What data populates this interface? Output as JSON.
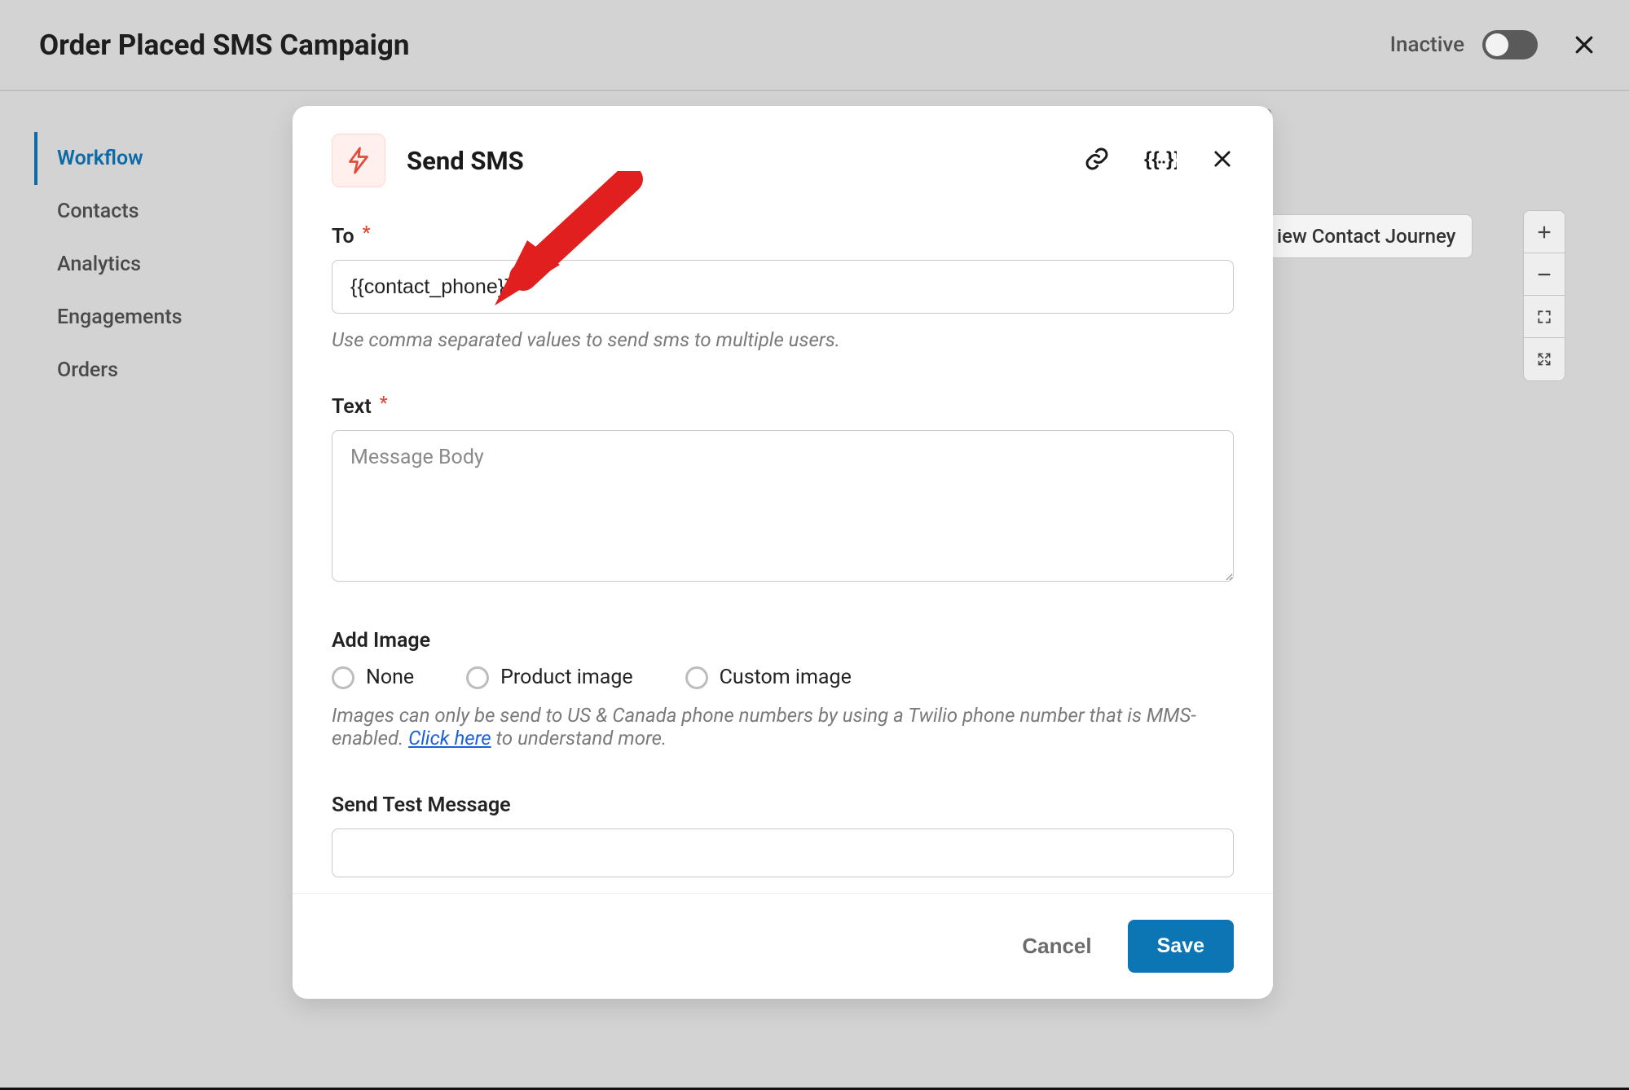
{
  "header": {
    "title": "Order Placed SMS Campaign",
    "status_label": "Inactive"
  },
  "sidebar": {
    "items": [
      {
        "label": "Workflow",
        "active": true
      },
      {
        "label": "Contacts",
        "active": false
      },
      {
        "label": "Analytics",
        "active": false
      },
      {
        "label": "Engagements",
        "active": false
      },
      {
        "label": "Orders",
        "active": false
      }
    ]
  },
  "canvas": {
    "view_contact_journey_label": "iew Contact Journey"
  },
  "modal": {
    "title": "Send SMS",
    "to": {
      "label": "To",
      "value": "{{contact_phone}}",
      "help": "Use comma separated values to send sms to multiple users."
    },
    "text": {
      "label": "Text",
      "placeholder": "Message Body",
      "value": ""
    },
    "add_image": {
      "label": "Add Image",
      "options": [
        {
          "label": "None"
        },
        {
          "label": "Product image"
        },
        {
          "label": "Custom image"
        }
      ],
      "help_pre": "Images can only be send to US & Canada phone numbers by using a Twilio phone number that is MMS-enabled. ",
      "help_link": "Click here",
      "help_post": " to understand more."
    },
    "send_test": {
      "label": "Send Test Message",
      "value": ""
    },
    "footer": {
      "cancel": "Cancel",
      "save": "Save"
    }
  }
}
